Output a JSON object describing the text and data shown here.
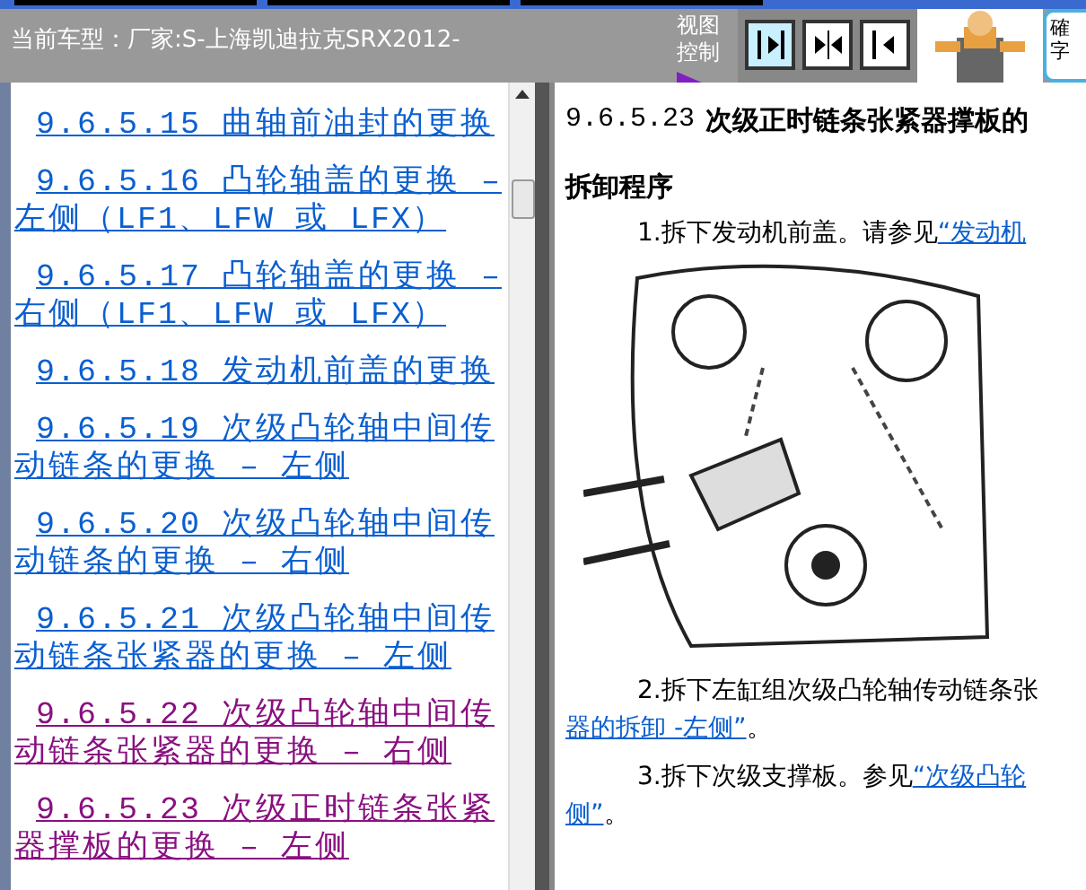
{
  "header": {
    "car_model": "当前车型：厂家:S-上海凯迪拉克SRX2012-",
    "view_control_label": "视图控制",
    "view_buttons": [
      {
        "kind": "right",
        "selected": true
      },
      {
        "kind": "both",
        "selected": false
      },
      {
        "kind": "left",
        "selected": false
      }
    ],
    "side_box": [
      "確",
      "字"
    ]
  },
  "toc": [
    {
      "text": "9.6.5.15 曲轴前油封的更换",
      "visited": false
    },
    {
      "text": "9.6.5.16 凸轮轴盖的更换 – 左侧（LF1、LFW 或 LFX）",
      "visited": false
    },
    {
      "text": "9.6.5.17 凸轮轴盖的更换 – 右侧（LF1、LFW 或 LFX）",
      "visited": false
    },
    {
      "text": "9.6.5.18 发动机前盖的更换",
      "visited": false
    },
    {
      "text": "9.6.5.19 次级凸轮轴中间传动链条的更换 – 左侧",
      "visited": false
    },
    {
      "text": "9.6.5.20 次级凸轮轴中间传动链条的更换 – 右侧",
      "visited": false
    },
    {
      "text": "9.6.5.21 次级凸轮轴中间传动链条张紧器的更换 – 左侧",
      "visited": false
    },
    {
      "text": "9.6.5.22 次级凸轮轴中间传动链条张紧器的更换 – 右侧",
      "visited": true
    },
    {
      "text": "9.6.5.23 次级正时链条张紧器撑板的更换 – 左侧",
      "visited": true
    }
  ],
  "content": {
    "title_number": "9.6.5.23",
    "title": "次级正时链条张紧器撑板的",
    "section": "拆卸程序",
    "steps": [
      {
        "number": "1.",
        "lines": [
          {
            "text": "拆下发动机前盖。请参见",
            "link": "“发动机"
          }
        ],
        "figure": true
      },
      {
        "number": "2.",
        "lines": [
          {
            "text": "拆下左缸组次级凸轮轴传动链条张"
          },
          {
            "link": "器的拆卸 -左侧”",
            "after": "。"
          }
        ]
      },
      {
        "number": "3.",
        "lines": [
          {
            "text": "拆下次级支撑板。参见",
            "link": "“次级凸轮"
          },
          {
            "link": "侧”",
            "after": "。"
          }
        ]
      }
    ]
  }
}
